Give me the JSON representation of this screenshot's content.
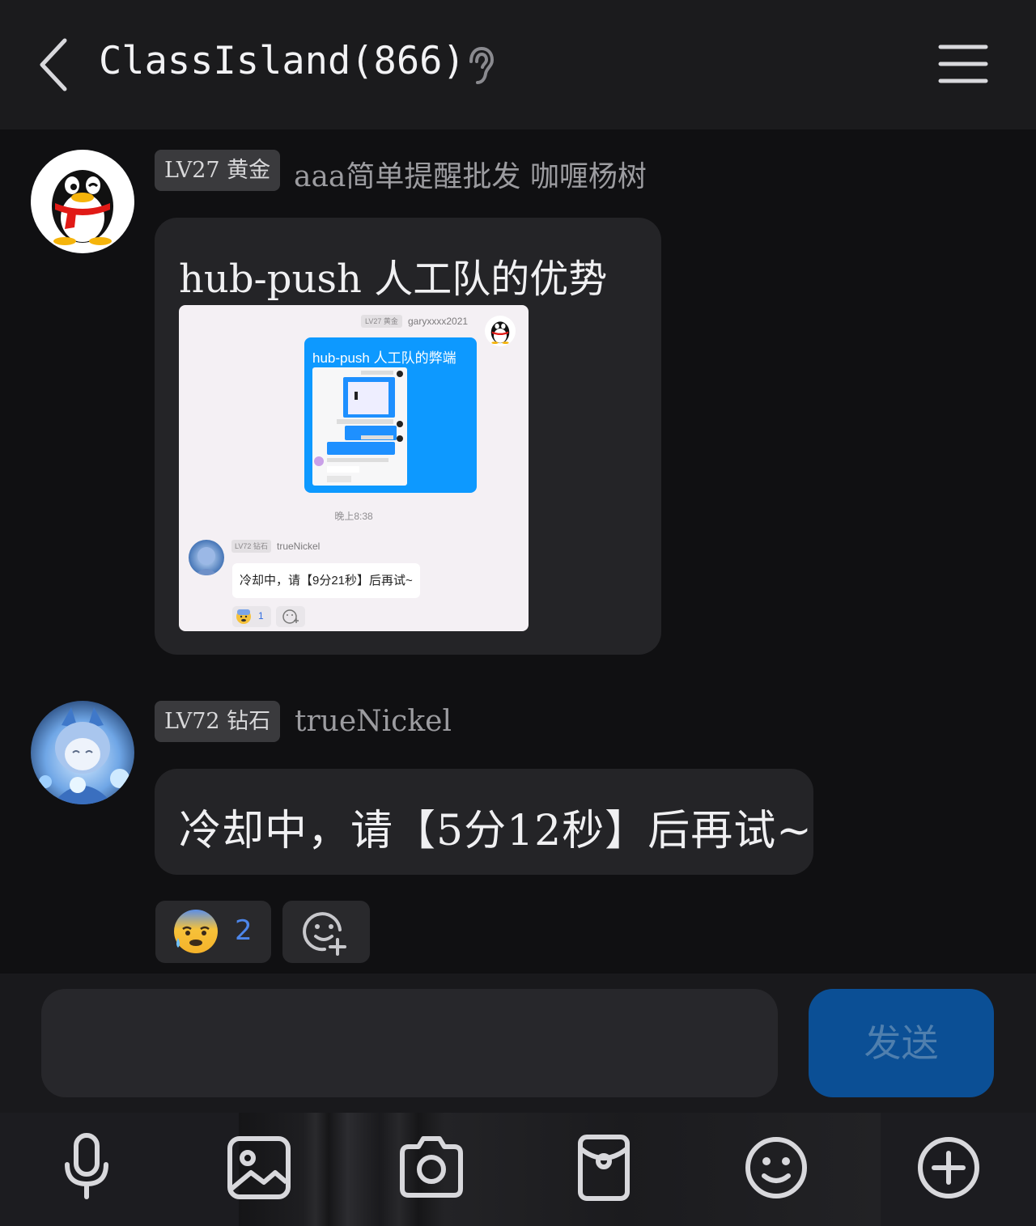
{
  "header": {
    "title": "ClassIsland(866)",
    "back_icon": "chevron-left-icon",
    "ear_icon": "ear-icon",
    "menu_icon": "hamburger-menu-icon"
  },
  "messages": [
    {
      "avatar": "qq-penguin-avatar",
      "badge": "LV27 黄金",
      "nickname": "aaa简单提醒批发 咖喱杨树",
      "text": "hub-push 人工队的优势",
      "attachment": {
        "badge": "LV27 黄金",
        "nickname": "garyxxxx2021",
        "bubble_text": "hub-push 人工队的弊端",
        "time": "晚上8:38",
        "reply_badge": "LV72 钻石",
        "reply_nickname": "trueNickel",
        "reply_text": "冷却中，请【9分21秒】后再试~",
        "reaction_count": "1"
      }
    },
    {
      "avatar": "anime-character-avatar",
      "badge": "LV72 钻石",
      "nickname": "trueNickel",
      "text": "冷却中，请【5分12秒】后再试~",
      "reaction": {
        "emoji": "anxious-sweat-emoji",
        "count": "2"
      },
      "add_reaction_icon": "add-reaction-icon"
    }
  ],
  "composer": {
    "input_value": "",
    "send_label": "发送"
  },
  "toolbar": [
    {
      "name": "microphone-icon"
    },
    {
      "name": "image-icon"
    },
    {
      "name": "camera-icon"
    },
    {
      "name": "red-packet-icon"
    },
    {
      "name": "emoji-icon"
    },
    {
      "name": "plus-circle-icon"
    }
  ],
  "colors": {
    "background": "#101012",
    "header": "#1b1b1d",
    "bubble": "#242427",
    "send_button": "#0b4f95",
    "reaction_count": "#4d86ea"
  }
}
